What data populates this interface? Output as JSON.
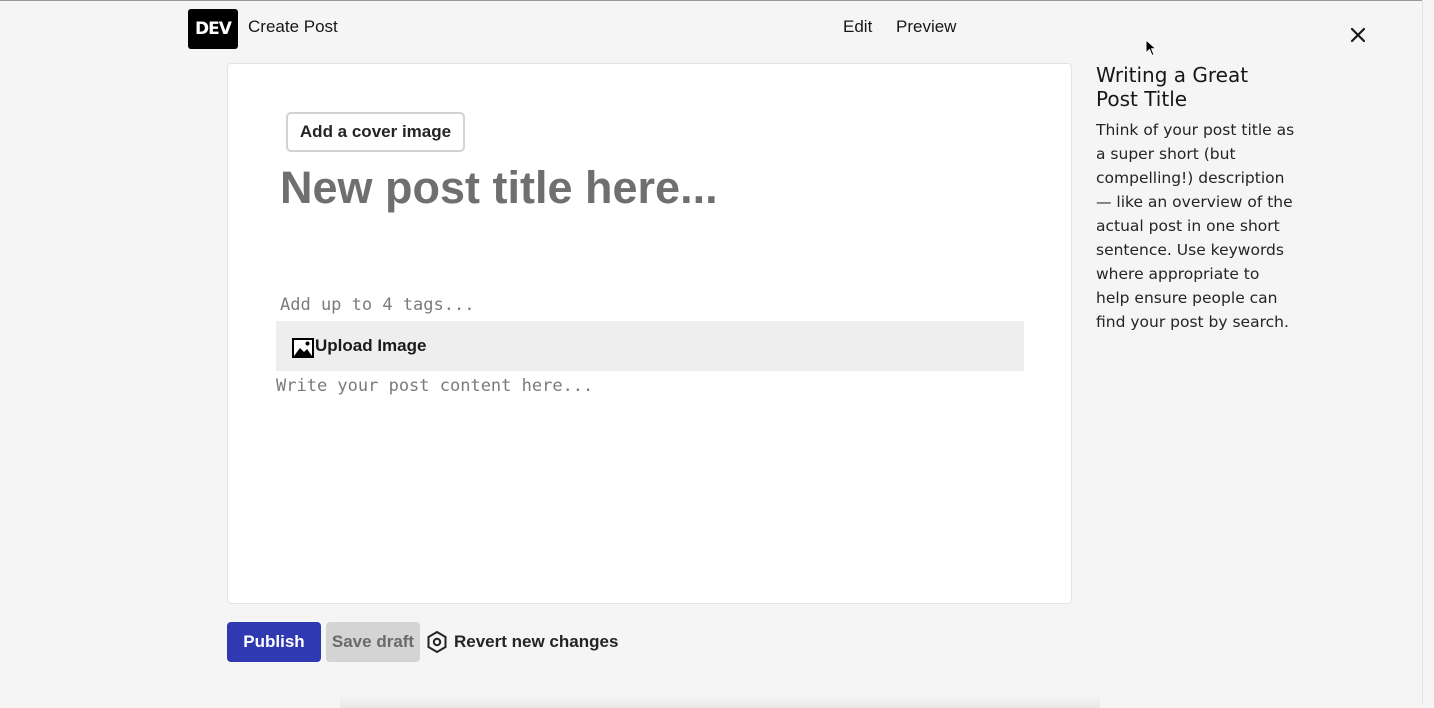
{
  "header": {
    "logo_text": "DEV",
    "page_title": "Create Post",
    "tabs": [
      {
        "label": "Edit"
      },
      {
        "label": "Preview"
      }
    ]
  },
  "editor": {
    "cover_button_label": "Add a cover image",
    "title_placeholder": "New post title here...",
    "tags_placeholder": "Add up to 4 tags...",
    "toolbar": {
      "upload_label": "Upload Image"
    },
    "body_placeholder": "Write your post content here..."
  },
  "actions": {
    "publish_label": "Publish",
    "save_draft_label": "Save draft",
    "revert_label": "Revert new changes"
  },
  "help": {
    "title": "Writing a Great Post Title",
    "body": "Think of your post title as a super short (but compelling!) description — like an overview of the actual post in one short sentence. Use keywords where appropriate to help ensure people can find your post by search."
  },
  "colors": {
    "publish": "#2f3ab2",
    "save_draft": "#d4d4d4",
    "background": "#f5f5f5"
  },
  "icons": {
    "logo": "dev-logo",
    "close": "close-icon",
    "upload": "image-icon",
    "revert": "hexagon-icon"
  }
}
